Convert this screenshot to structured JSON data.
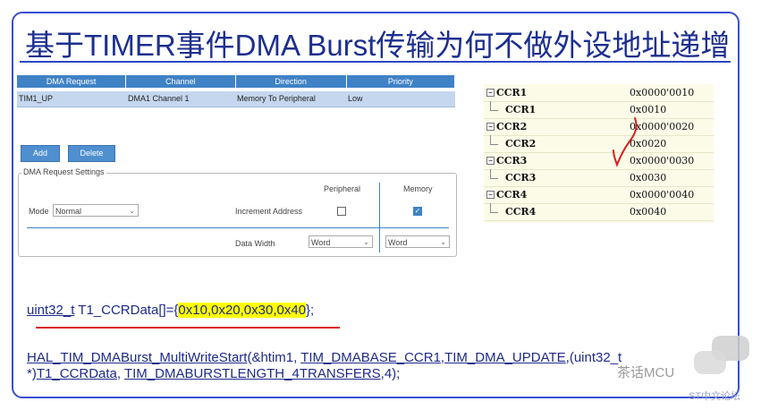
{
  "title": "基于TIMER事件DMA Burst传输为何不做外设地址递增",
  "dma_table": {
    "headers": [
      "DMA Request",
      "Channel",
      "Direction",
      "Priority"
    ],
    "row": [
      "TIM1_UP",
      "DMA1 Channel 1",
      "Memory To Peripheral",
      "Low"
    ]
  },
  "buttons": {
    "add": "Add",
    "delete": "Delete"
  },
  "settings": {
    "legend": "DMA Request Settings",
    "col_peripheral": "Peripheral",
    "col_memory": "Memory",
    "mode_label": "Mode",
    "mode_value": "Normal",
    "increment_label": "Increment Address",
    "peripheral_increment": false,
    "memory_increment": true,
    "data_width_label": "Data Width",
    "peripheral_width": "Word",
    "memory_width": "Word"
  },
  "registers": [
    {
      "name": "CCR1",
      "value": "0x0000'0010",
      "child": false
    },
    {
      "name": "CCR1",
      "value": "0x0010",
      "child": true
    },
    {
      "name": "CCR2",
      "value": "0x0000'0020",
      "child": false
    },
    {
      "name": "CCR2",
      "value": "0x0020",
      "child": true
    },
    {
      "name": "CCR3",
      "value": "0x0000'0030",
      "child": false
    },
    {
      "name": "CCR3",
      "value": "0x0030",
      "child": true
    },
    {
      "name": "CCR4",
      "value": "0x0000'0040",
      "child": false
    },
    {
      "name": "CCR4",
      "value": "0x0040",
      "child": true
    }
  ],
  "code": {
    "line1_a": "uint32_t",
    "line1_b": " T1_CCRData[]={",
    "line1_hl": "0x10,0x20,0x30,0x40",
    "line1_c": "};",
    "line2_a": "HAL_TIM_DMABurst_MultiWriteStart",
    "line2_b": "(&htim1, ",
    "line2_c": "TIM_DMABASE_CCR1",
    "line2_d": ",",
    "line2_e": "TIM_DMA_UPDATE",
    "line2_f": ",(uint32_t",
    "line3_a": "*)",
    "line3_b": "T1_CCRData",
    "line3_c": ", ",
    "line3_d": "TIM_DMABURSTLENGTH_4TRANSFERS",
    "line3_e": ",4);"
  },
  "watermark": {
    "text": "茶话MCU",
    "source": "ST中文论坛"
  },
  "colors": {
    "title": "#1d2f8f",
    "frame": "#3a4fd0",
    "header": "#3f82c6",
    "highlight": "#ffff00",
    "annotation": "#d81e1e"
  }
}
